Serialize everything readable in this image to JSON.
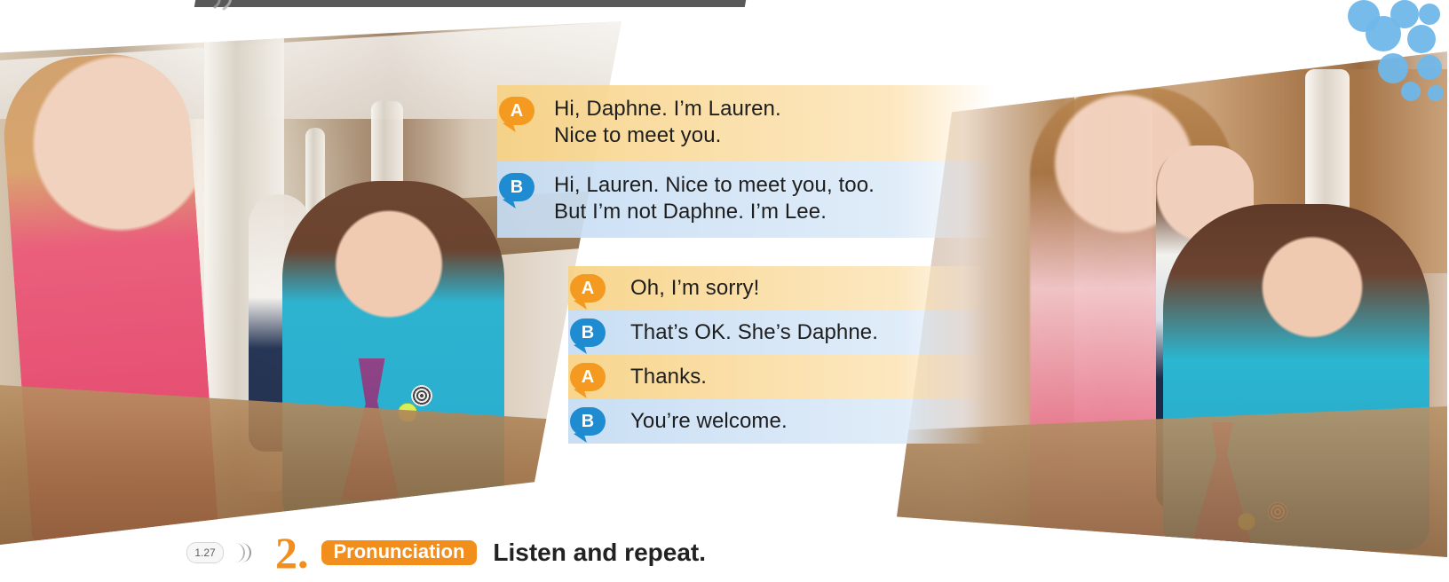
{
  "dialogue": {
    "lines": [
      {
        "speaker": "A",
        "text": "Hi, Daphne. I’m Lauren.\nNice to meet you."
      },
      {
        "speaker": "B",
        "text": "Hi, Lauren. Nice to meet you, too.\nBut I’m not Daphne. I’m Lee."
      },
      {
        "speaker": "A",
        "text": "Oh, I’m sorry!"
      },
      {
        "speaker": "B",
        "text": "That’s OK. She’s Daphne."
      },
      {
        "speaker": "A",
        "text": "Thanks."
      },
      {
        "speaker": "B",
        "text": "You’re welcome."
      }
    ]
  },
  "section": {
    "track": "1.27",
    "number": "2.",
    "tag": "Pronunciation",
    "instruction": "Listen and repeat."
  },
  "colors": {
    "orange": "#F28E1C",
    "blue": "#1F8BD1",
    "orange_strip": "#F7D284",
    "blue_strip": "#C5DCF3"
  },
  "icons": {
    "audio": "audio-icon",
    "speech_bubble": "speech-bubble-icon"
  }
}
